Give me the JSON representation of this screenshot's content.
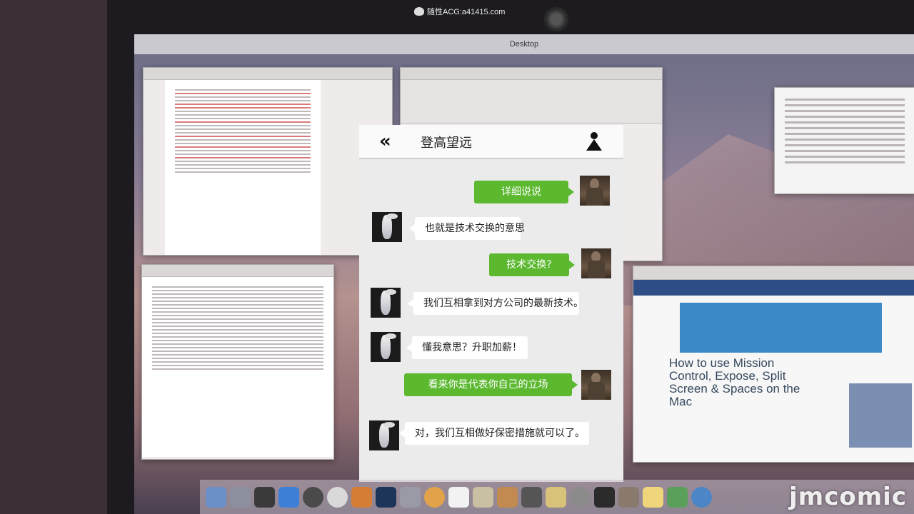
{
  "top_watermark": "随性ACG:a41415.com",
  "desktop": {
    "title": "Desktop"
  },
  "macworld": {
    "headline": "How to use Mission Control, Expose, Split Screen & Spaces on the Mac"
  },
  "chat": {
    "title": "登高望远",
    "messages": [
      {
        "side": "me",
        "text": "详细说说"
      },
      {
        "side": "them",
        "text": "也就是技术交换的意思"
      },
      {
        "side": "me",
        "text": "技术交换?"
      },
      {
        "side": "them",
        "text": "我们互相拿到对方公司的最新技术。"
      },
      {
        "side": "them",
        "text": "懂我意思？升职加薪！"
      },
      {
        "side": "me",
        "text": "看来你是代表你自己的立场"
      },
      {
        "side": "them",
        "text": "对，我们互相做好保密措施就可以了。"
      }
    ]
  },
  "colors": {
    "bubble_green": "#5bb82f",
    "chat_bg": "#ebebeb"
  },
  "watermark_bottom": "jmcomic"
}
